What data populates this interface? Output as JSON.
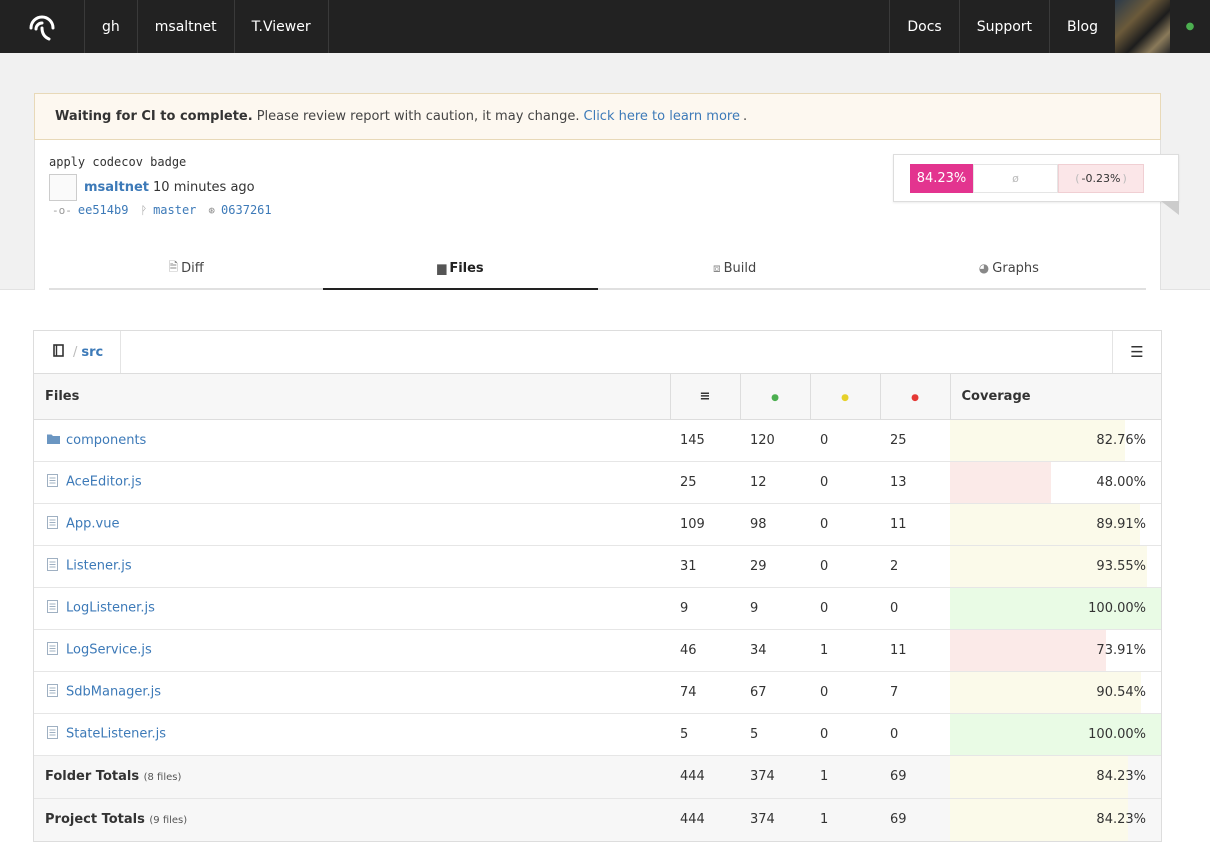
{
  "nav": {
    "left_items": [
      "gh",
      "msaltnet",
      "T.Viewer"
    ],
    "right_items": [
      "Docs",
      "Support",
      "Blog"
    ]
  },
  "notice": {
    "bold": "Waiting for CI to complete.",
    "text": "Please review report with caution, it may change.",
    "link": "Click here to learn more",
    "end": "."
  },
  "commit": {
    "message": "apply codecov badge",
    "author": "msaltnet",
    "time": "10 minutes ago",
    "sha": "ee514b9",
    "branch": "master",
    "base": "0637261"
  },
  "coverage_summary": {
    "head": "84.23%",
    "diff_symbol": "ø",
    "change": "-0.23%",
    "head_color": "#e3348f"
  },
  "tabs": [
    {
      "label": "Diff",
      "icon": "diff-file-icon"
    },
    {
      "label": "Files",
      "icon": "folder-icon",
      "active": true
    },
    {
      "label": "Build",
      "icon": "box-icon"
    },
    {
      "label": "Graphs",
      "icon": "pie-chart-icon"
    }
  ],
  "breadcrumb": {
    "folder": "src",
    "separator": "/"
  },
  "table": {
    "headers": {
      "files": "Files",
      "coverage": "Coverage"
    },
    "header_colors": {
      "hits": "#4caf50",
      "partials": "#e6d12b",
      "misses": "#e53935"
    },
    "rows": [
      {
        "name": "components",
        "type": "folder",
        "lines": "145",
        "hits": "120",
        "partials": "0",
        "misses": "25",
        "coverage": "82.76%",
        "pct": 82.76
      },
      {
        "name": "AceEditor.js",
        "type": "file",
        "lines": "25",
        "hits": "12",
        "partials": "0",
        "misses": "13",
        "coverage": "48.00%",
        "pct": 48.0
      },
      {
        "name": "App.vue",
        "type": "file",
        "lines": "109",
        "hits": "98",
        "partials": "0",
        "misses": "11",
        "coverage": "89.91%",
        "pct": 89.91
      },
      {
        "name": "Listener.js",
        "type": "file",
        "lines": "31",
        "hits": "29",
        "partials": "0",
        "misses": "2",
        "coverage": "93.55%",
        "pct": 93.55
      },
      {
        "name": "LogListener.js",
        "type": "file",
        "lines": "9",
        "hits": "9",
        "partials": "0",
        "misses": "0",
        "coverage": "100.00%",
        "pct": 100.0
      },
      {
        "name": "LogService.js",
        "type": "file",
        "lines": "46",
        "hits": "34",
        "partials": "1",
        "misses": "11",
        "coverage": "73.91%",
        "pct": 73.91
      },
      {
        "name": "SdbManager.js",
        "type": "file",
        "lines": "74",
        "hits": "67",
        "partials": "0",
        "misses": "7",
        "coverage": "90.54%",
        "pct": 90.54
      },
      {
        "name": "StateListener.js",
        "type": "file",
        "lines": "5",
        "hits": "5",
        "partials": "0",
        "misses": "0",
        "coverage": "100.00%",
        "pct": 100.0
      }
    ],
    "totals": [
      {
        "label": "Folder Totals",
        "note": "(8 files)",
        "lines": "444",
        "hits": "374",
        "partials": "1",
        "misses": "69",
        "coverage": "84.23%",
        "pct": 84.23
      },
      {
        "label": "Project Totals",
        "note": "(9 files)",
        "lines": "444",
        "hits": "374",
        "partials": "1",
        "misses": "69",
        "coverage": "84.23%",
        "pct": 84.23
      }
    ]
  }
}
